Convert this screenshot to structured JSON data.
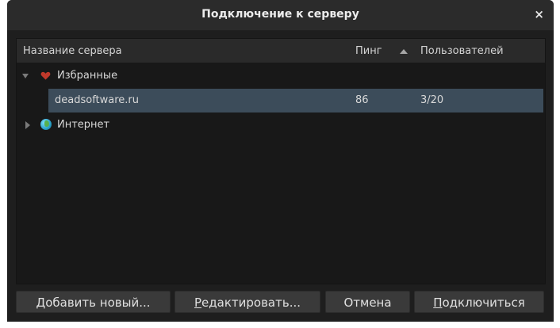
{
  "window": {
    "title": "Подключение к серверу",
    "close_glyph": "×"
  },
  "table": {
    "columns": {
      "name": "Название сервера",
      "ping": "Пинг",
      "users": "Пользователей"
    },
    "sort": {
      "column": "ping",
      "direction": "ascending"
    },
    "groups": [
      {
        "label": "Избранные",
        "icon": "heart-icon",
        "expanded": true,
        "servers": [
          {
            "name": "deadsoftware.ru",
            "ping": "86",
            "users": "3/20",
            "selected": true
          }
        ]
      },
      {
        "label": "Интернет",
        "icon": "globe-icon",
        "expanded": false,
        "servers": []
      }
    ]
  },
  "buttons": {
    "add": {
      "mnemonic": "Д",
      "rest": "обавить новый..."
    },
    "edit": {
      "mnemonic": "Р",
      "rest": "едактировать..."
    },
    "cancel": {
      "label": "Отмена"
    },
    "connect": {
      "mnemonic": "П",
      "rest": "одключиться"
    }
  },
  "colors": {
    "window_bg": "#1e1e1e",
    "selection": "#3c4c5a",
    "heart": "#c0392b"
  }
}
